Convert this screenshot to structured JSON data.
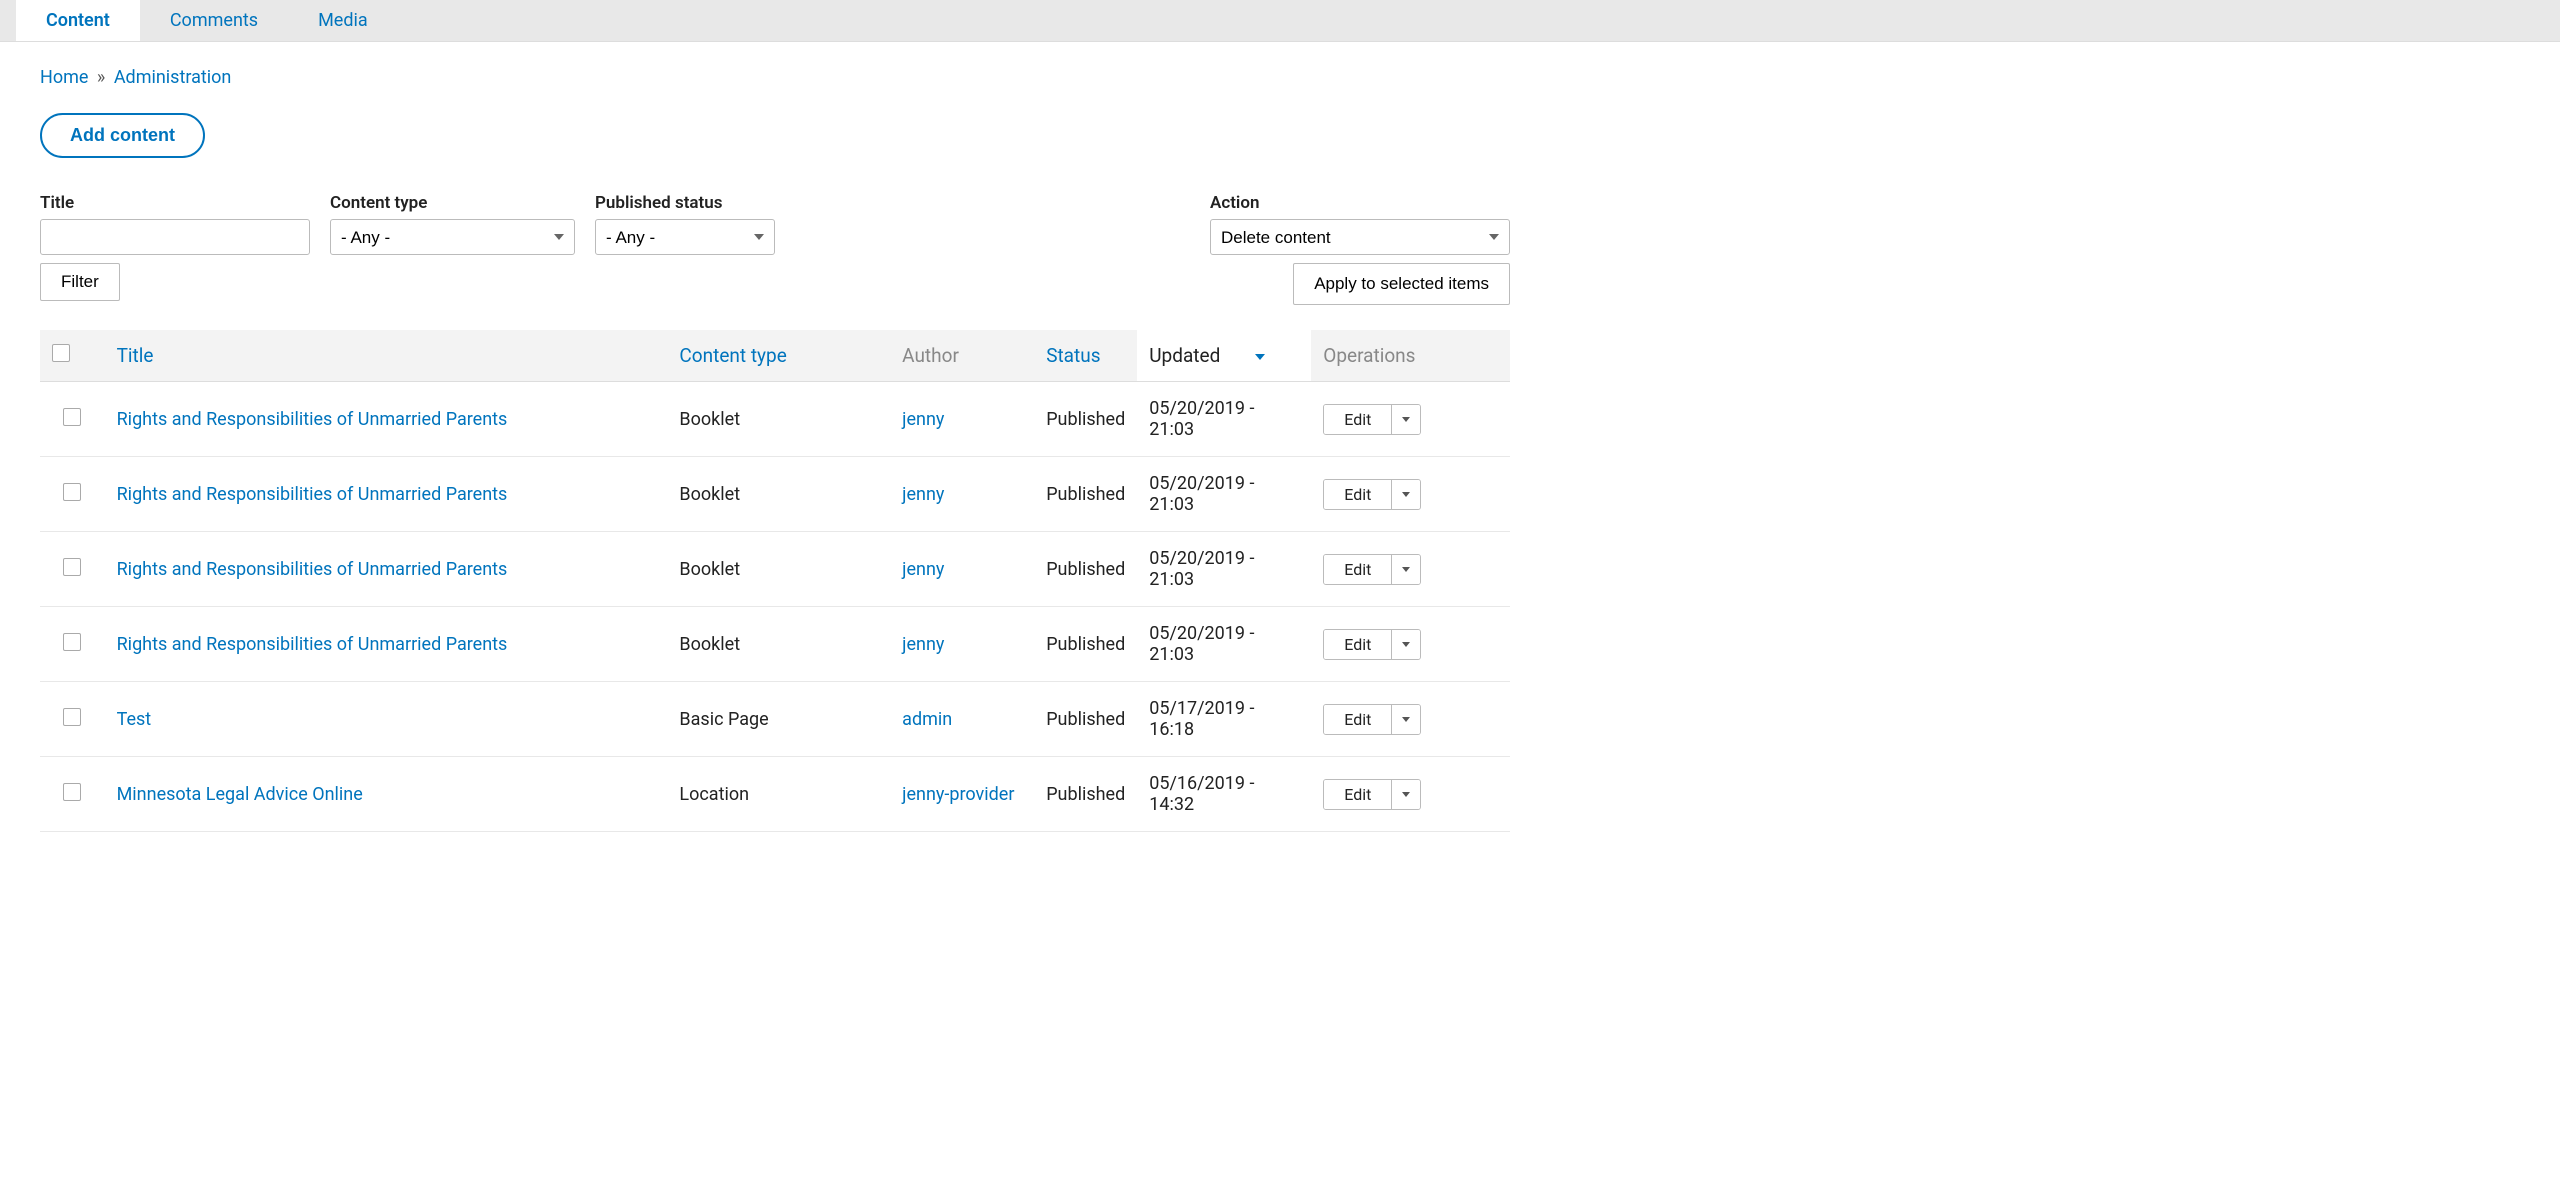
{
  "tabs": [
    {
      "label": "Content",
      "active": true
    },
    {
      "label": "Comments",
      "active": false
    },
    {
      "label": "Media",
      "active": false
    }
  ],
  "breadcrumb": {
    "home": "Home",
    "sep": "»",
    "current": "Administration"
  },
  "add_content_label": "Add content",
  "filters": {
    "title_label": "Title",
    "title_value": "",
    "content_type_label": "Content type",
    "content_type_value": "- Any -",
    "published_status_label": "Published status",
    "published_status_value": "- Any -",
    "filter_button": "Filter"
  },
  "actions": {
    "action_label": "Action",
    "action_value": "Delete content",
    "apply_button": "Apply to selected items"
  },
  "table": {
    "headers": {
      "title": "Title",
      "content_type": "Content type",
      "author": "Author",
      "status": "Status",
      "updated": "Updated",
      "operations": "Operations"
    },
    "rows": [
      {
        "title": "Rights and Responsibilities of Unmarried Parents",
        "content_type": "Booklet",
        "author": "jenny",
        "status": "Published",
        "updated": "05/20/2019 - 21:03",
        "op": "Edit"
      },
      {
        "title": "Rights and Responsibilities of Unmarried Parents",
        "content_type": "Booklet",
        "author": "jenny",
        "status": "Published",
        "updated": "05/20/2019 - 21:03",
        "op": "Edit"
      },
      {
        "title": "Rights and Responsibilities of Unmarried Parents",
        "content_type": "Booklet",
        "author": "jenny",
        "status": "Published",
        "updated": "05/20/2019 - 21:03",
        "op": "Edit"
      },
      {
        "title": "Rights and Responsibilities of Unmarried Parents",
        "content_type": "Booklet",
        "author": "jenny",
        "status": "Published",
        "updated": "05/20/2019 - 21:03",
        "op": "Edit"
      },
      {
        "title": "Test",
        "content_type": "Basic Page",
        "author": "admin",
        "status": "Published",
        "updated": "05/17/2019 - 16:18",
        "op": "Edit"
      },
      {
        "title": "Minnesota Legal Advice Online",
        "content_type": "Location",
        "author": "jenny-provider",
        "status": "Published",
        "updated": "05/16/2019 - 14:32",
        "op": "Edit"
      }
    ]
  }
}
